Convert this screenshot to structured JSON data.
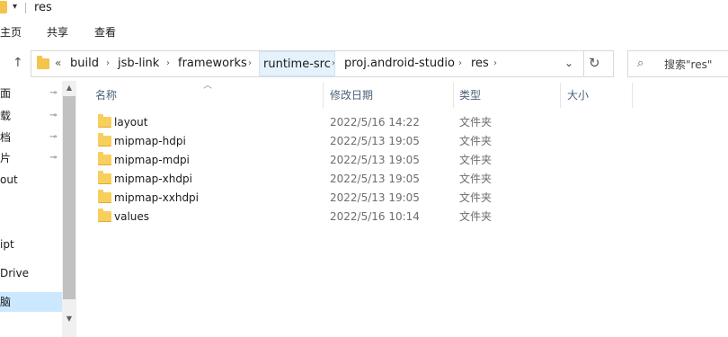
{
  "window": {
    "title": "res",
    "qa_dropdown": "▾"
  },
  "ribbon": {
    "tabs": [
      "主页",
      "共享",
      "查看"
    ]
  },
  "address": {
    "up_icon": "arrow-up-icon",
    "overflow": "«",
    "crumbs": [
      "build",
      "jsb-link",
      "frameworks",
      "runtime-src",
      "proj.android-studio",
      "res"
    ],
    "sep": "›",
    "dropdown": "⌄",
    "refresh": "↻"
  },
  "search": {
    "icon": "⌕",
    "placeholder": "搜索\"res\""
  },
  "navpane": {
    "items": [
      {
        "label": "面",
        "pinned": true
      },
      {
        "label": "载",
        "pinned": true
      },
      {
        "label": "档",
        "pinned": true
      },
      {
        "label": "片",
        "pinned": true
      },
      {
        "label": "out",
        "pinned": false
      },
      {
        "label": "ipt",
        "pinned": false
      },
      {
        "label": "Drive",
        "pinned": false
      },
      {
        "label": "脑",
        "pinned": false
      }
    ],
    "pin_glyph": "📌",
    "scroll_up": "▲",
    "scroll_down": "▼"
  },
  "columns": {
    "name": "名称",
    "modified": "修改日期",
    "type": "类型",
    "size": "大小",
    "sort_glyph": "︿"
  },
  "files": [
    {
      "name": "layout",
      "modified": "2022/5/16 14:22",
      "type": "文件夹"
    },
    {
      "name": "mipmap-hdpi",
      "modified": "2022/5/13 19:05",
      "type": "文件夹"
    },
    {
      "name": "mipmap-mdpi",
      "modified": "2022/5/13 19:05",
      "type": "文件夹"
    },
    {
      "name": "mipmap-xhdpi",
      "modified": "2022/5/13 19:05",
      "type": "文件夹"
    },
    {
      "name": "mipmap-xxhdpi",
      "modified": "2022/5/13 19:05",
      "type": "文件夹"
    },
    {
      "name": "values",
      "modified": "2022/5/16 10:14",
      "type": "文件夹"
    }
  ],
  "colors": {
    "folder": "#f7cf5c",
    "selected": "#cce8ff",
    "header_text": "#4c607a"
  }
}
